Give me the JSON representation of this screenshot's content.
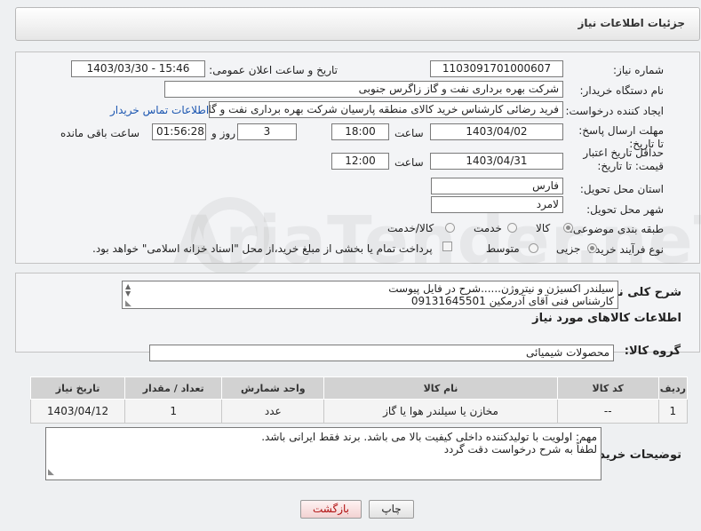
{
  "header": {
    "title": "جزئیات اطلاعات نیاز"
  },
  "fields": {
    "need_number_label": "شماره نیاز:",
    "need_number": "1103091701000607",
    "announce_label": "تاریخ و ساعت اعلان عمومی:",
    "announce_value": "1403/03/30 - 15:46",
    "buyer_org_label": "نام دستگاه خریدار:",
    "buyer_org": "شرکت بهره برداری نفت و گاز زاگرس جنوبی",
    "creator_label": "ایجاد کننده درخواست:",
    "creator": "فرید رضائی کارشناس خرید کالای منطقه پارسیان شرکت بهره برداری نفت و گاز",
    "contact_link": "اطلاعات تماس خریدار",
    "reply_deadline_label": "مهلت ارسال پاسخ: تا تاریخ:",
    "reply_date": "1403/04/02",
    "time_label": "ساعت",
    "reply_time": "18:00",
    "days_value": "3",
    "days_label": "روز و",
    "remaining_time": "01:56:28",
    "remaining_label": "ساعت باقی مانده",
    "price_validity_label": "حداقل تاریخ اعتبار قیمت: تا تاریخ:",
    "price_date": "1403/04/31",
    "price_time": "12:00",
    "province_label": "استان محل تحویل:",
    "province": "فارس",
    "city_label": "شهر محل تحویل:",
    "city": "لامرد",
    "category_label": "طبقه بندی موضوعی:",
    "category_options": [
      "کالا",
      "خدمت",
      "کالا/خدمت"
    ],
    "process_label": "نوع فرآیند خرید :",
    "process_options": [
      "جزیی",
      "متوسط"
    ],
    "payment_note": "پرداخت تمام یا بخشی از مبلغ خرید،از محل \"اسناد خزانه اسلامی\" خواهد بود."
  },
  "description": {
    "label": "شرح کلی نیاز:",
    "line1": "سیلندر اکسیژن و نیتروژن......شرح در فایل پیوست",
    "line2": "کارشناس فنی آقای آدرمکین 09131645501"
  },
  "goods_section": {
    "title": "اطلاعات کالاهای مورد نیاز",
    "group_label": "گروه کالا:",
    "group_value": "محصولات شیمیائی"
  },
  "goods_table": {
    "headers": [
      "ردیف",
      "کد کالا",
      "نام کالا",
      "واحد شمارش",
      "تعداد / مقدار",
      "تاریخ نیاز"
    ],
    "rows": [
      [
        "1",
        "--",
        "مخازن یا سیلندر هوا یا گاز",
        "عدد",
        "1",
        "1403/04/12"
      ]
    ]
  },
  "buyer_notes": {
    "label": "توضیحات خریدار:",
    "line1": "مهم: اولویت با تولیدکننده داخلی کیفیت بالا می باشد. برند فقط ایرانی باشد.",
    "line2": "لطفاً به شرح درخواست دقت گردد"
  },
  "buttons": {
    "print": "چاپ",
    "back": "بازگشت"
  },
  "watermark": "AriaTender.neT"
}
